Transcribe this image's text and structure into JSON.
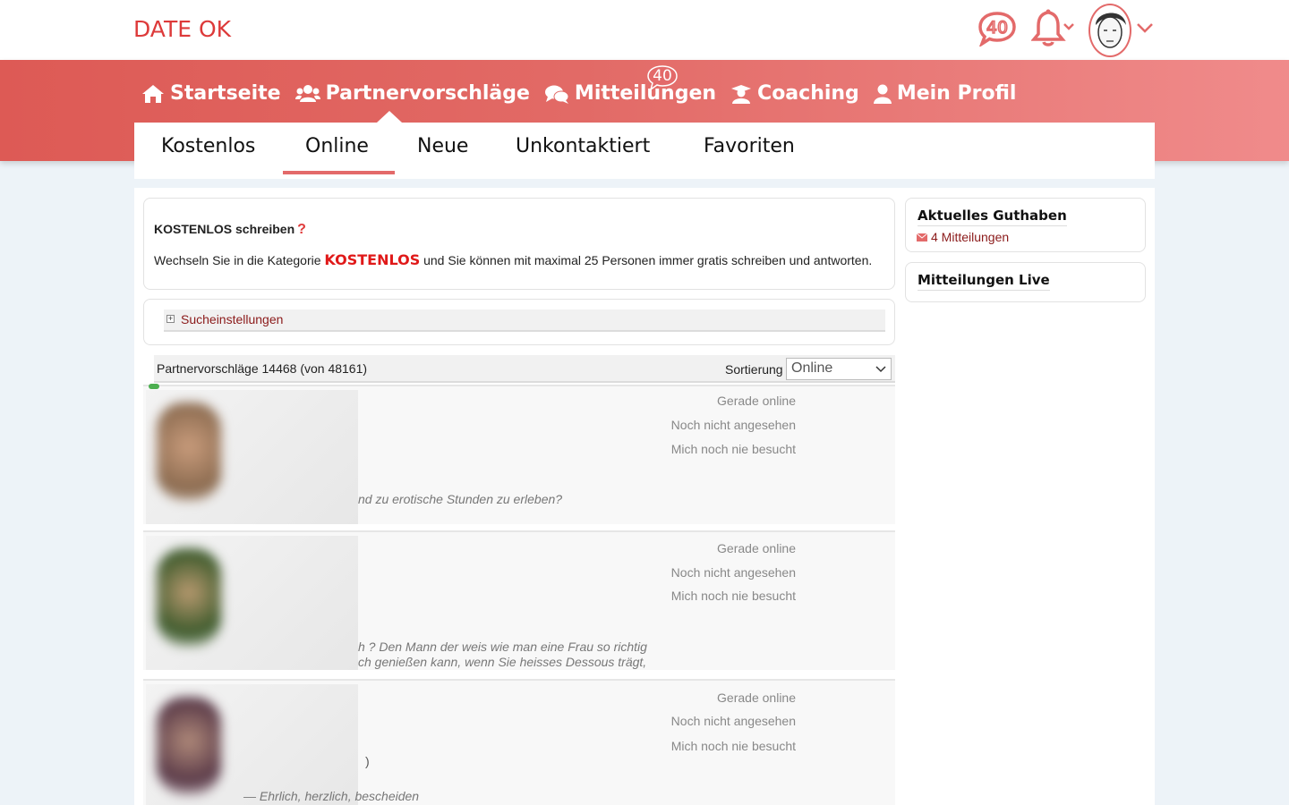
{
  "brand": {
    "logo": "DATE OK",
    "accent": "#dd3a3a"
  },
  "header": {
    "chat_count": "40",
    "nav_badge": "40"
  },
  "mainnav": {
    "items": [
      {
        "label": "Startseite",
        "icon": "home-icon"
      },
      {
        "label": "Partnervorschläge",
        "icon": "users-icon"
      },
      {
        "label": "Mitteilungen",
        "icon": "comments-icon"
      },
      {
        "label": "Coaching",
        "icon": "coach-icon"
      },
      {
        "label": "Mein Profil",
        "icon": "user-icon"
      }
    ]
  },
  "subtabs": [
    "Kostenlos",
    "Online",
    "Neue",
    "Unkontaktiert",
    "Favoriten"
  ],
  "kostenlos_box": {
    "title": "KOSTENLOS schreiben",
    "question": "?",
    "text_before": "Wechseln Sie in die Kategorie ",
    "highlight": "KOSTENLOS",
    "text_after": " und Sie können mit maximal 25 Personen immer gratis schreiben und antworten."
  },
  "search": {
    "label": "Sucheinstellungen",
    "toggle": "+"
  },
  "results": {
    "count_text": "Partnervorschläge 14468 (von 48161)",
    "sort_label": "Sortierung",
    "sort_value": "Online"
  },
  "rows": [
    {
      "status1": "Gerade online",
      "status2": "Noch nicht angesehen",
      "status3": "Mich noch nie besucht",
      "quote1": "nd zu erotische Stunden zu erleben?",
      "quote2": ""
    },
    {
      "status1": "Gerade online",
      "status2": "Noch nicht angesehen",
      "status3": "Mich noch nie besucht",
      "quote1": "h ? Den Mann der weis wie man eine Frau so richtig",
      "quote2": "ch genießen kann, wenn Sie heisses Dessous trägt,"
    },
    {
      "status1": "Gerade online",
      "status2": "Noch nicht angesehen",
      "status3": "Mich noch nie besucht",
      "quote1": ")",
      "quote2": "—  Ehrlich, herzlich, bescheiden"
    }
  ],
  "sidebar": {
    "balance_title": "Aktuelles Guthaben",
    "balance_value": "4 Mitteilungen",
    "live_title": "Mitteilungen Live"
  }
}
